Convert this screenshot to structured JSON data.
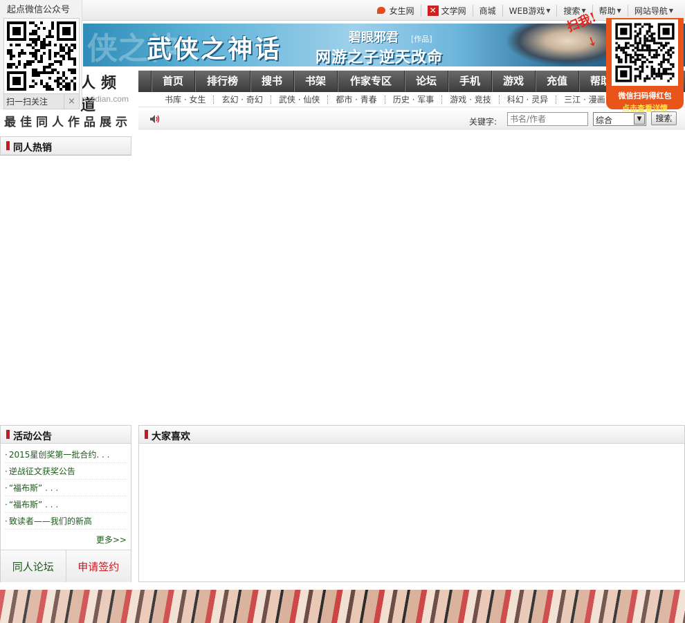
{
  "wechat_box": {
    "title": "起点微信公众号",
    "scan_label": "扫一扫关注",
    "close_glyph": "×"
  },
  "top_nav": {
    "items": [
      {
        "label": "女生网",
        "icon": "qd-women-logo-icon",
        "dropdown": false
      },
      {
        "label": "文学网",
        "icon": "wenxue-logo-icon",
        "dropdown": false
      },
      {
        "label": "商城",
        "icon": null,
        "dropdown": false
      },
      {
        "label": "WEB游戏",
        "icon": null,
        "dropdown": true
      },
      {
        "label": "搜索",
        "icon": null,
        "dropdown": true
      },
      {
        "label": "帮助",
        "icon": null,
        "dropdown": true
      },
      {
        "label": "网站导航",
        "icon": null,
        "dropdown": true
      }
    ]
  },
  "channel_logo": {
    "name": "人频道",
    "domain": "n.qidian.com",
    "slogan": "最佳同人作品展示"
  },
  "banner": {
    "ghost_text": "侠之神",
    "title": "武侠之神话",
    "author": "碧眼邪君",
    "tag": "[作品]",
    "subtitle": "网游之子逆天改命"
  },
  "main_nav": {
    "items": [
      {
        "label": "首页",
        "width": 63
      },
      {
        "label": "排行榜",
        "width": 80
      },
      {
        "label": "搜书",
        "width": 63
      },
      {
        "label": "书架",
        "width": 63
      },
      {
        "label": "作家专区",
        "width": 97
      },
      {
        "label": "论坛",
        "width": 63
      },
      {
        "label": "手机",
        "width": 63
      },
      {
        "label": "游戏",
        "width": 63
      },
      {
        "label": "充值",
        "width": 63
      },
      {
        "label": "帮助",
        "width": 63
      }
    ]
  },
  "sub_nav": {
    "items": [
      "书库 · 女生",
      "玄幻 · 奇幻",
      "武侠 · 仙侠",
      "都市 · 青春",
      "历史 · 军事",
      "游戏 · 竞技",
      "科幻 · 灵异",
      "三江 · 漫画"
    ]
  },
  "search": {
    "keyword_label": "关键字:",
    "placeholder": "书名/作者",
    "scope_value": "综合",
    "button_label": "搜索"
  },
  "sections": {
    "hot": {
      "title": "同人热销"
    },
    "notice": {
      "title": "活动公告",
      "items": [
        "2015星创奖第一批合约. . .",
        "逆战征文获奖公告",
        "“福布斯” . . .",
        "“福布斯” . . .",
        "致读者——我们的新高"
      ],
      "more_label": "更多>>",
      "forum_button": "同人论坛",
      "sign_button": "申请签约"
    },
    "like": {
      "title": "大家喜欢"
    }
  },
  "promo": {
    "scan_text": "扫我!",
    "line1": "微信扫码得红包",
    "line2": "点击查看详情",
    "close_glyph": "X"
  }
}
